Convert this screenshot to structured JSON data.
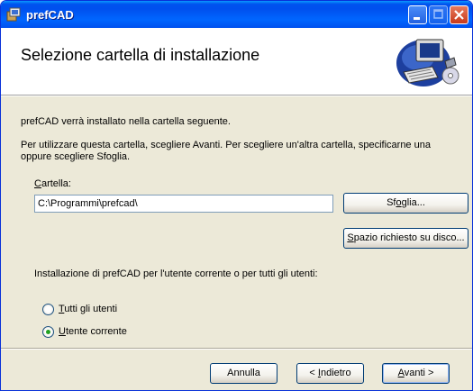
{
  "window": {
    "title": "prefCAD"
  },
  "header": {
    "title": "Selezione cartella di installazione"
  },
  "content": {
    "intro": "prefCAD verrà installato nella cartella seguente.",
    "instructions_line1": "Per utilizzare questa cartella, scegliere Avanti. Per scegliere un'altra cartella, specificarne una",
    "instructions_line2": "oppure scegliere Sfoglia.",
    "folder_label_accel": "C",
    "folder_label_rest": "artella:",
    "folder_value": "C:\\Programmi\\prefcad\\",
    "browse_button": {
      "pre": "Sf",
      "accel": "o",
      "post": "glia..."
    },
    "disk_space_button": {
      "pre": "",
      "accel": "S",
      "post": "pazio richiesto su disco..."
    },
    "scope_question": "Installazione di prefCAD per l'utente corrente o per tutti gli utenti:",
    "radio_all": {
      "accel": "T",
      "rest": "utti gli utenti",
      "selected": false
    },
    "radio_current": {
      "accel": "U",
      "rest": "tente corrente",
      "selected": true
    }
  },
  "footer": {
    "cancel_button": "Annulla",
    "back_button": {
      "pre": "< ",
      "accel": "I",
      "post": "ndietro"
    },
    "next_button": {
      "pre": "",
      "accel": "A",
      "post": "vanti >"
    }
  },
  "icons": [
    "installer-app-icon",
    "minimize-icon",
    "maximize-icon",
    "close-icon",
    "computer-setup-icon"
  ],
  "colors": {
    "titlebar": "#0053ee",
    "dialog_bg": "#ece9d8",
    "header_bg": "#ffffff",
    "radio_selected": "#21a121"
  }
}
